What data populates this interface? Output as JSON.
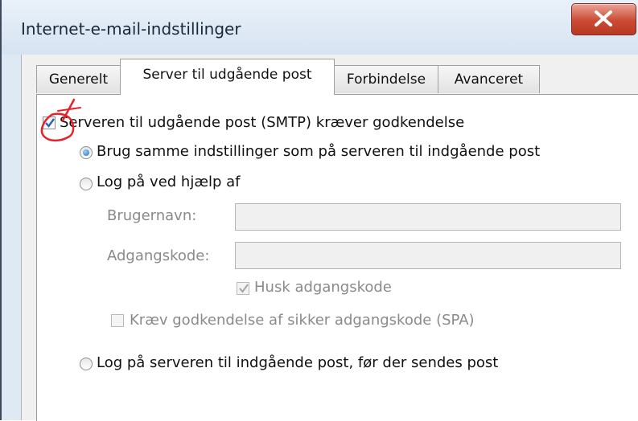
{
  "window": {
    "title": "Internet-e-mail-indstillinger",
    "close_icon": "close-icon"
  },
  "tabs": [
    {
      "label": "Generelt",
      "active": false
    },
    {
      "label": "Server til udgående post",
      "active": true
    },
    {
      "label": "Forbindelse",
      "active": false
    },
    {
      "label": "Avanceret",
      "active": false
    }
  ],
  "smtp_auth": {
    "label": "Serveren til udgående post (SMTP) kræver godkendelse",
    "checked": true
  },
  "options": {
    "same_settings": {
      "label": "Brug samme indstillinger som på serveren til indgående post",
      "selected": true
    },
    "log_on_using": {
      "label": "Log på ved hjælp af",
      "selected": false
    },
    "log_on_incoming": {
      "label": "Log på serveren til indgående post, før der sendes post",
      "selected": false
    }
  },
  "credentials": {
    "username_label": "Brugernavn:",
    "username_value": "",
    "password_label": "Adgangskode:",
    "password_value": "",
    "remember_label": "Husk adgangskode",
    "remember_checked": true,
    "spa_label": "Kræv godkendelse af sikker adgangskode (SPA)",
    "spa_checked": false
  },
  "colors": {
    "annotation": "#e8202a",
    "title_bar": "#dfe9f4",
    "close_button": "#cb4a33"
  }
}
